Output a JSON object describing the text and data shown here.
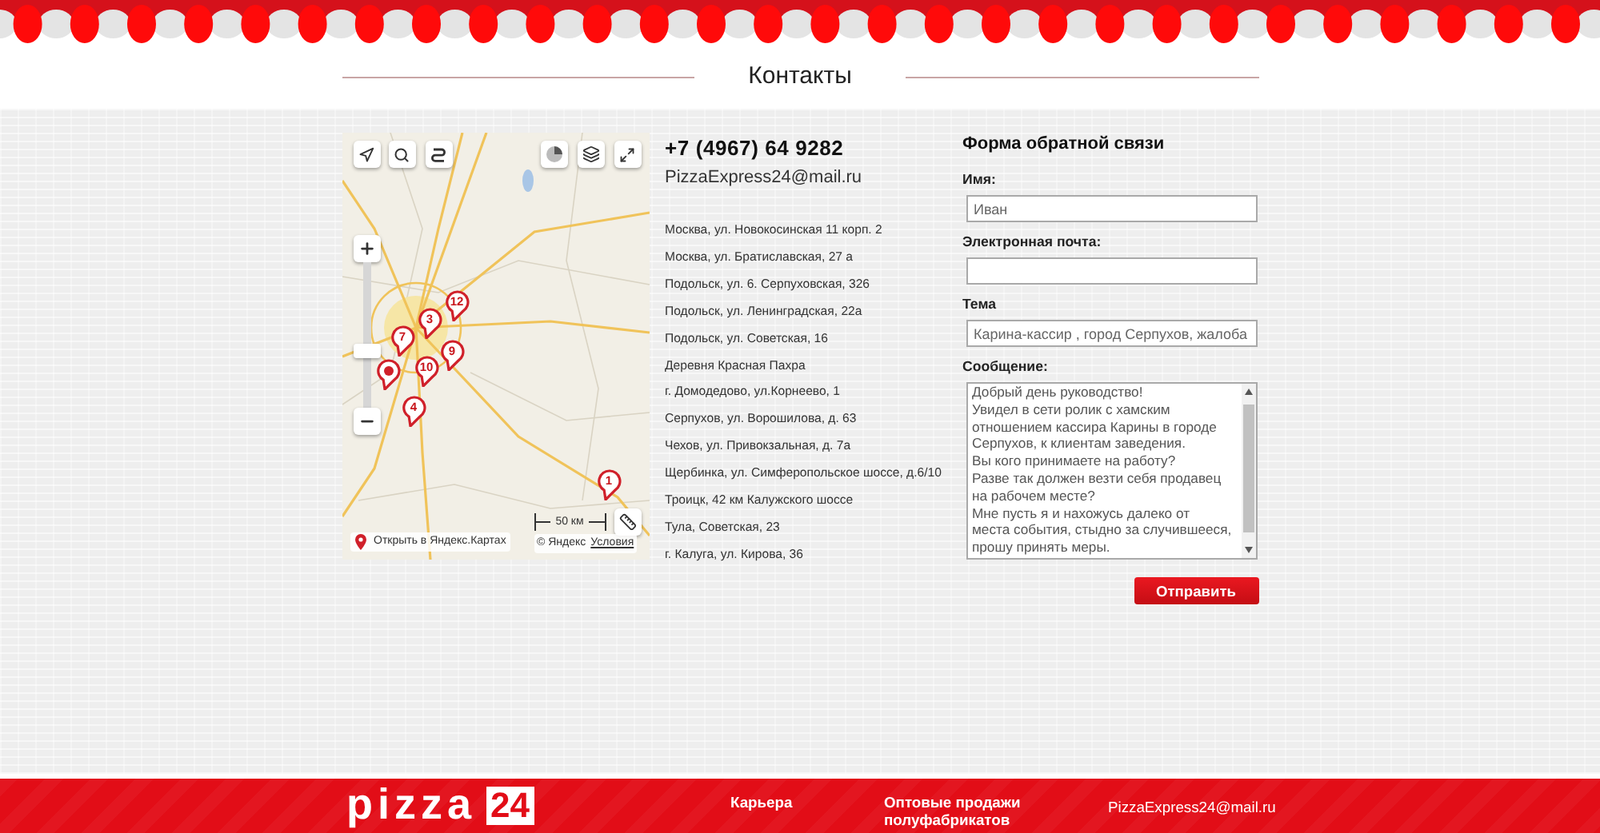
{
  "page": {
    "title": "Контакты"
  },
  "map": {
    "markers": [
      {
        "label": "12"
      },
      {
        "label": "3"
      },
      {
        "label": "7"
      },
      {
        "label": "9"
      },
      {
        "label": "10"
      },
      {
        "label": "4"
      },
      {
        "label": "1"
      }
    ],
    "zoom": {
      "level": 0.38
    },
    "scale": "50 км",
    "open_link": "Открыть в Яндекс.Картах",
    "copyright": "© Яндекс",
    "terms_link": "Условия"
  },
  "contacts": {
    "phone": "+7 (4967) 64 9282",
    "email": "PizzaExpress24@mail.ru",
    "addresses": [
      "Москва, ул. Новокосинская 11 корп. 2",
      "Москва, ул. Братиславская, 27 а",
      "Подольск, ул. 6. Серпуховская, 326",
      "Подольск, ул. Ленинградская, 22а",
      "Подольск, ул. Советская, 16",
      "Деревня Красная Пахра",
      "г. Домодедово, ул.Корнеево, 1",
      "Серпухов, ул. Ворошилова, д. 63",
      "Чехов, ул. Привокзальная, д. 7а",
      "Щербинка, ул. Симферопольское шоссе, д.6/10",
      "Троицк, 42 км Калужского шоссе",
      "Тула, Советская, 23",
      "г. Калуга, ул. Кирова, 36"
    ]
  },
  "form": {
    "title": "Форма обратной связи",
    "fields": [
      {
        "label": "Имя:",
        "kind": "input",
        "value": "Иван"
      },
      {
        "label": "Электронная почта:",
        "kind": "input"
      },
      {
        "label": "Тема",
        "kind": "input",
        "value": "Карина-кассир , город Серпухов, жалоба"
      },
      {
        "label": "Сообщение:",
        "kind": "textarea",
        "lines": [
          "Добрый день руководство!",
          "Увидел в сети ролик с хамским",
          "отношением кассира Карины в городе",
          "Серпухов, к клиентам заведения.",
          "Вы кого принимаете на работу?",
          "Разве так должен везти себя продавец",
          "на рабочем месте?",
          "Мне пусть я и нахожусь далеко от",
          "места события, стыдно за случившееся,",
          "прошу принять меры."
        ]
      }
    ],
    "submit": "Отправить"
  },
  "footer": {
    "logo": {
      "text": "pizza",
      "badge": "24"
    },
    "links": [
      "Карьера",
      "Оптовые продажи полуфабрикатов"
    ],
    "email": "PizzaExpress24@mail.ru"
  }
}
